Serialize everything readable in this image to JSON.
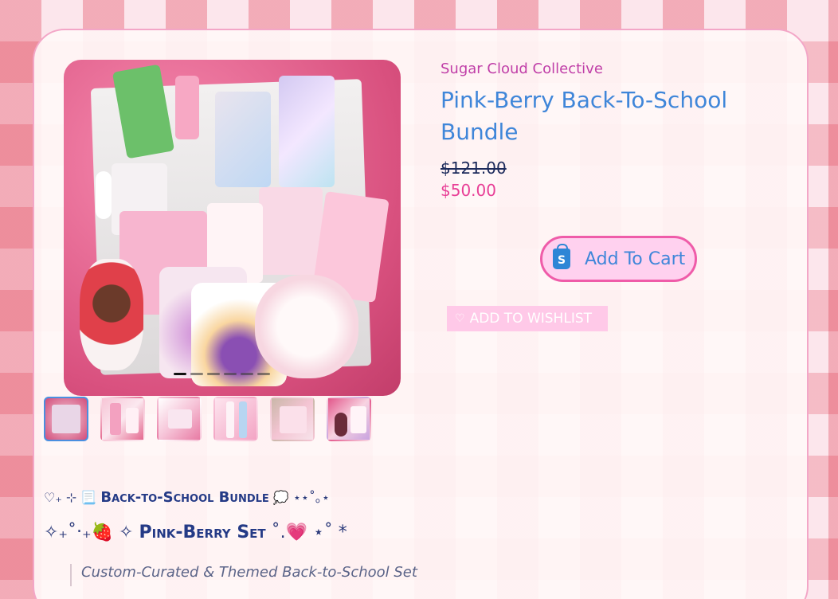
{
  "product": {
    "vendor": "Sugar Cloud Collective",
    "title": "Pink-Berry Back-To-School Bundle",
    "compare_price": "$121.00",
    "price": "$50.00",
    "cart_label": "Add To Cart",
    "wishlist_label": "ADD TO WISHLIST"
  },
  "gallery": {
    "slide_count": 6,
    "active_index": 0,
    "thumbnail_count": 6
  },
  "description": {
    "line1_prefix": "♡₊ ⊹ 📃",
    "line1_title": "Back-to-School Bundle",
    "line1_suffix": "💭 ⋆⋆˚｡⋆",
    "line2_prefix": "✧₊˚‧₊🍓 ✧",
    "line2_title": "Pink-Berry Set",
    "line2_suffix": "˚.💗 ⋆˚ *",
    "quote": "Custom-Curated & Themed Back-to-School Set"
  },
  "icons": {
    "cart": "shopify-bag-icon",
    "wishlist": "heart-icon",
    "gallery_next": "chevron-right-icon"
  },
  "colors": {
    "title": "#3f86d9",
    "vendor": "#c03fa8",
    "price": "#e83e96",
    "cart_border": "#ef5ca9",
    "wishlist_bg": "#ffc9e8",
    "thumb_active": "#4a8fe0"
  }
}
